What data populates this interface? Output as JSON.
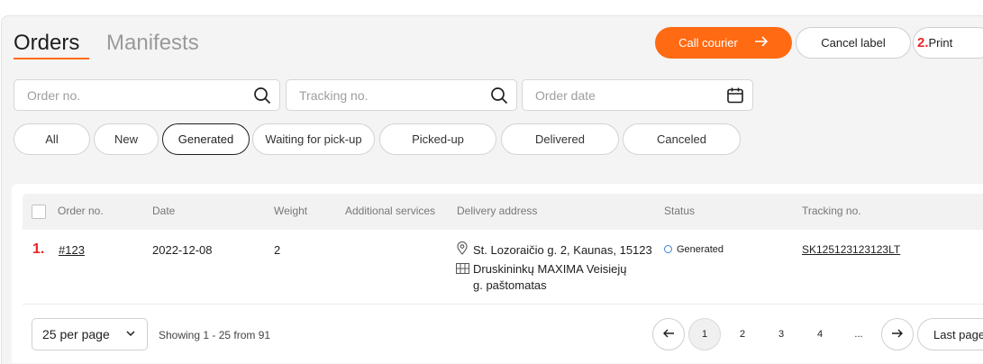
{
  "tabs": {
    "orders": "Orders",
    "manifests": "Manifests"
  },
  "actions": {
    "call_courier": "Call courier",
    "cancel_label": "Cancel label",
    "print_marker": "2.",
    "print": "Print"
  },
  "search": {
    "order_no_placeholder": "Order no.",
    "tracking_no_placeholder": "Tracking no.",
    "order_date_placeholder": "Order date"
  },
  "filters": [
    {
      "label": "All",
      "active": false
    },
    {
      "label": "New",
      "active": false
    },
    {
      "label": "Generated",
      "active": true
    },
    {
      "label": "Waiting for pick-up",
      "active": false
    },
    {
      "label": "Picked-up",
      "active": false
    },
    {
      "label": "Delivered",
      "active": false
    },
    {
      "label": "Canceled",
      "active": false
    }
  ],
  "table": {
    "columns": [
      "Order no.",
      "Date",
      "Weight",
      "Additional services",
      "Delivery address",
      "Status",
      "Tracking no."
    ],
    "rows": [
      {
        "marker": "1.",
        "order_no": "#123",
        "date": "2022-12-08",
        "weight": "2",
        "additional_services": "",
        "address_line": "St. Lozoraičio g. 2, Kaunas, 15123",
        "pickup_line_1": "Druskininkų MAXIMA Veisiejų",
        "pickup_line_2": "g. paštomatas",
        "status": "Generated",
        "tracking_no": "SK125123123123LT"
      }
    ]
  },
  "pagination": {
    "per_page": "25 per page",
    "showing": "Showing 1 - 25 from 91",
    "pages": [
      "1",
      "2",
      "3",
      "4",
      "..."
    ],
    "current": "1",
    "last_page": "Last page"
  },
  "colors": {
    "accent": "#ff6a13",
    "marker": "#e8282b",
    "status": "#3b82d6"
  }
}
